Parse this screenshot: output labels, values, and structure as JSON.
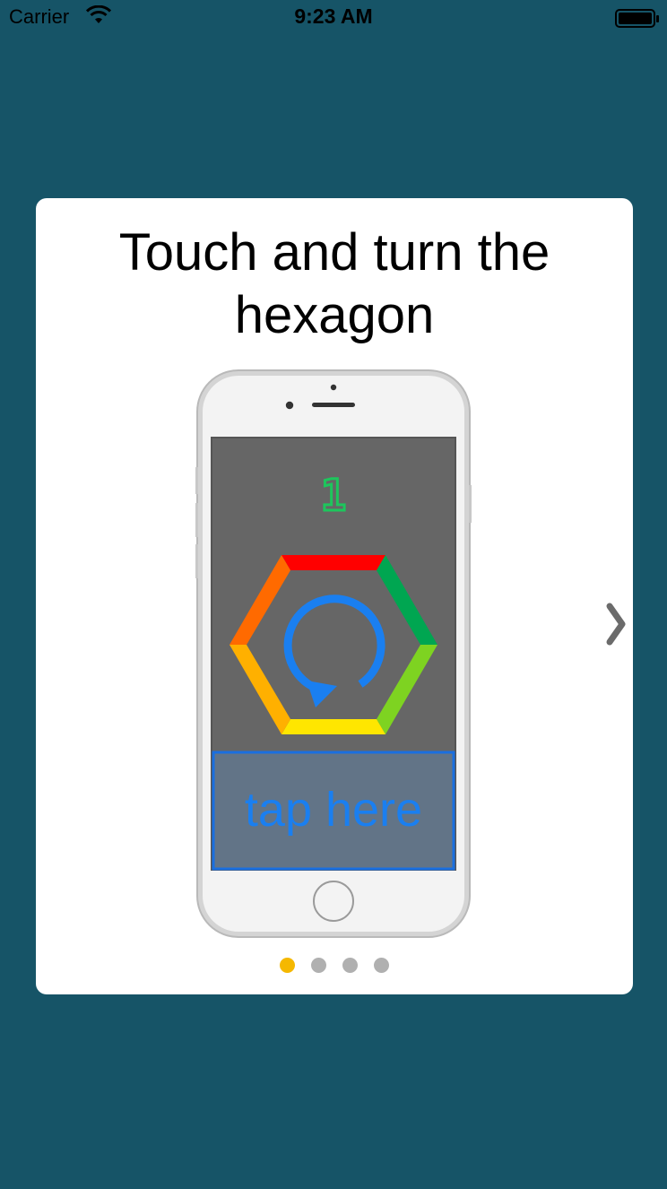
{
  "status_bar": {
    "carrier": "Carrier",
    "time": "9:23 AM"
  },
  "tutorial": {
    "title_line1": "Touch and turn the",
    "title_line2": "hexagon",
    "phone_screen": {
      "score": "1",
      "tap_label": "tap here",
      "hexagon_colors": [
        "#ff0000",
        "#00a651",
        "#7ed321",
        "#ffe600",
        "#ffb000",
        "#ff6a00"
      ]
    },
    "pager": {
      "total": 4,
      "current": 1
    }
  },
  "colors": {
    "background": "#165467",
    "card": "#ffffff",
    "active_dot": "#f5b800",
    "inactive_dot": "#b0b0b0",
    "accent_blue": "#1a7ff0"
  }
}
